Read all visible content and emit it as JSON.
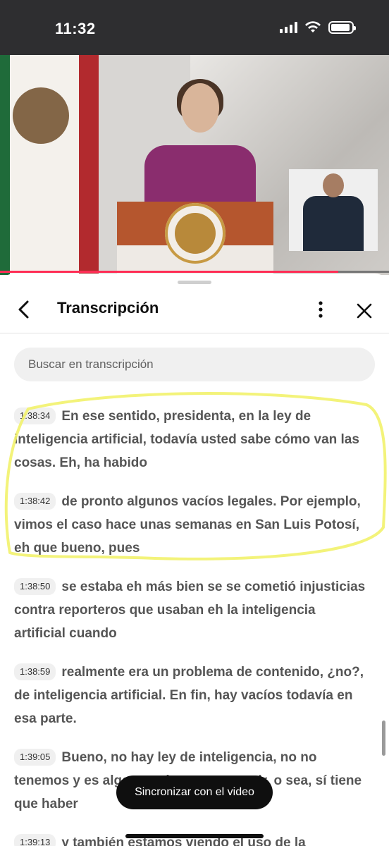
{
  "status_bar": {
    "time": "11:32"
  },
  "video": {
    "progress": 0.87,
    "accent": "#ff2d55"
  },
  "sheet": {
    "title": "Transcripción",
    "search_placeholder": "Buscar en transcripción",
    "segments": [
      {
        "timestamp": "1:38:34",
        "text": "En ese sentido, presidenta, en la ley de inteligencia artificial, todavía usted sabe cómo van las cosas. Eh, ha habido"
      },
      {
        "timestamp": "1:38:42",
        "text": "de pronto algunos vacíos legales. Por ejemplo, vimos el caso hace unas semanas en San Luis Potosí, eh que bueno, pues"
      },
      {
        "timestamp": "1:38:50",
        "text": "se estaba eh más bien se se cometió injusticias contra reporteros que usaban eh la inteligencia artificial cuando"
      },
      {
        "timestamp": "1:38:59",
        "text": "realmente era un problema de contenido, ¿no?, de inteligencia artificial. En fin, hay vacíos todavía en esa parte."
      },
      {
        "timestamp": "1:39:05",
        "text": "Bueno, no hay ley de inteligencia, no no tenemos y es algo que tiene que ocurrir, o sea, sí tiene que haber"
      },
      {
        "timestamp": "1:39:13",
        "text": "y también estamos viendo el uso de la"
      }
    ],
    "toast": "Sincronizar con el video",
    "highlight_color": "#f2f26b"
  },
  "icons": {
    "back": "chevron-left-icon",
    "more": "more-vertical-icon",
    "close": "close-icon"
  }
}
